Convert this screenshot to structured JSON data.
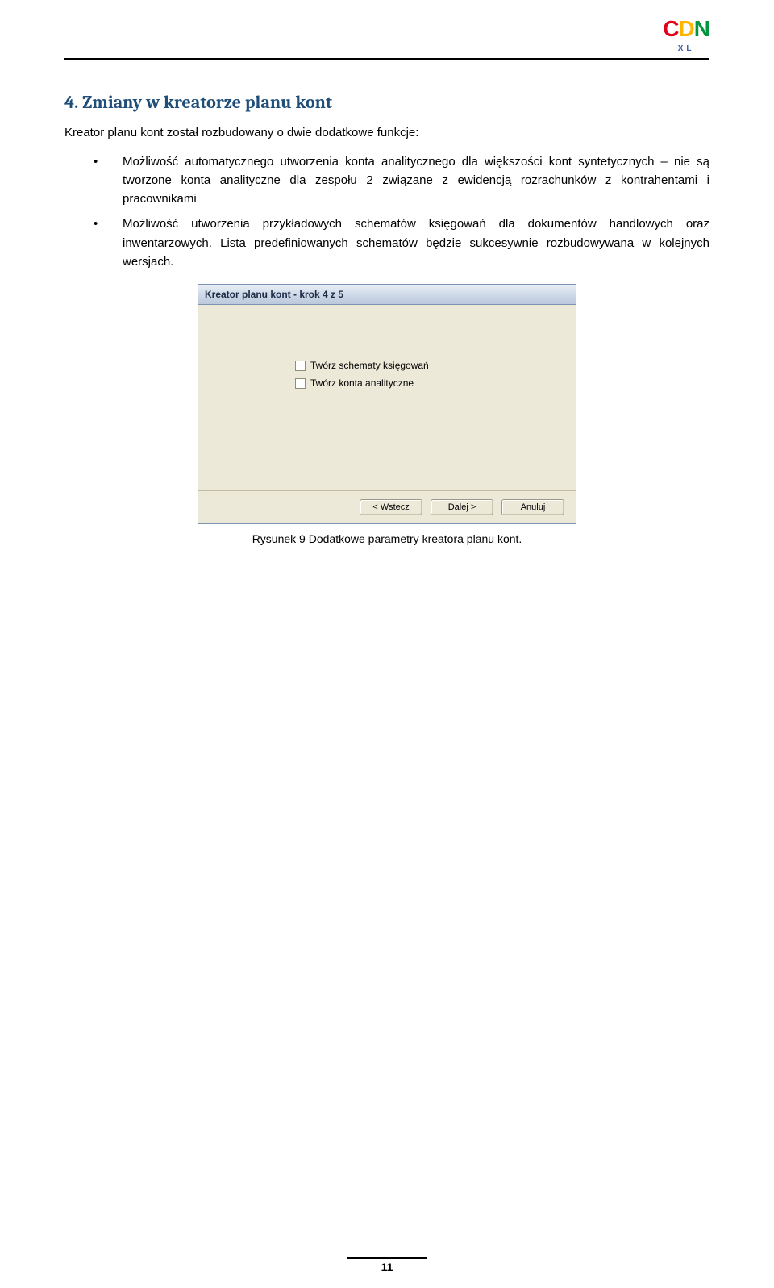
{
  "logo": {
    "c": "C",
    "d": "D",
    "n": "N",
    "xl": "XL"
  },
  "heading": "4.  Zmiany w kreatorze planu kont",
  "paragraph": "Kreator planu kont został rozbudowany o dwie dodatkowe funkcje:",
  "bullets": [
    "Możliwość automatycznego utworzenia konta analitycznego dla większości kont syntetycznych – nie są tworzone konta analityczne dla zespołu 2 związane z ewidencją rozrachunków z kontrahentami i pracownikami",
    "Możliwość utworzenia przykładowych schematów księgowań dla dokumentów handlowych oraz inwentarzowych. Lista predefiniowanych schematów będzie sukcesywnie rozbudowywana w kolejnych wersjach."
  ],
  "wizard": {
    "title": "Kreator planu kont - krok 4 z 5",
    "checkbox1": "Twórz schematy księgowań",
    "checkbox2": "Twórz konta analityczne",
    "buttons": {
      "back_pre": "< ",
      "back_u": "W",
      "back_post": "stecz",
      "next": "Dalej >",
      "cancel": "Anuluj"
    }
  },
  "caption": "Rysunek 9 Dodatkowe parametry kreatora planu kont.",
  "page_number": "11"
}
